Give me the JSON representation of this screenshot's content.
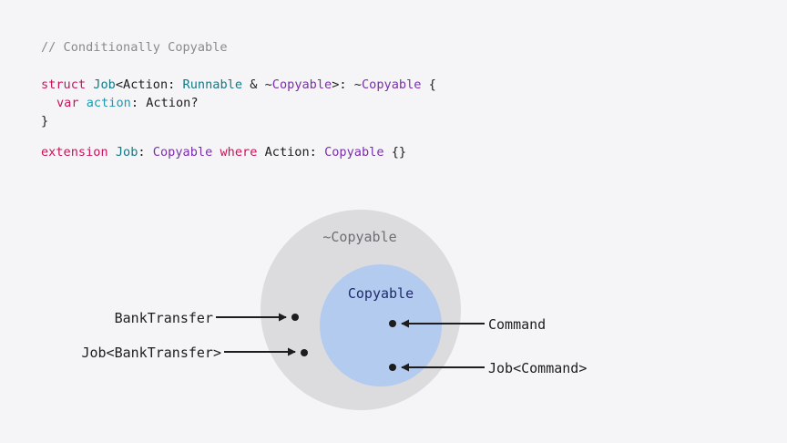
{
  "code": {
    "comment": "// Conditionally Copyable",
    "line1": {
      "kw_struct": "struct",
      "job": "Job",
      "lt_action": "<Action: ",
      "runnable": "Runnable",
      "amp_tilde": " & ~",
      "copyable": "Copyable",
      "gt_colon_tilde": ">: ~",
      "copyable2": "Copyable",
      "brace": " {"
    },
    "line2": {
      "kw_var": "var",
      "action": "action",
      "rest": ": Action?"
    },
    "line3": "}",
    "line4": {
      "kw_extension": "extension",
      "job": "Job",
      "colon": ": ",
      "copyable": "Copyable",
      "kw_where": "where",
      "action_colon": " Action: ",
      "copyable2": "Copyable",
      "braces": " {}"
    }
  },
  "diagram": {
    "outer_label": "~Copyable",
    "inner_label": "Copyable",
    "labels": {
      "bank_transfer": "BankTransfer",
      "job_bank_transfer": "Job<BankTransfer>",
      "command": "Command",
      "job_command": "Job<Command>"
    },
    "colors": {
      "outer_circle": "#dcdcdf",
      "inner_circle": "#b3cbef",
      "inner_label": "#1f2b6b",
      "outer_label": "#6e6e73"
    }
  }
}
